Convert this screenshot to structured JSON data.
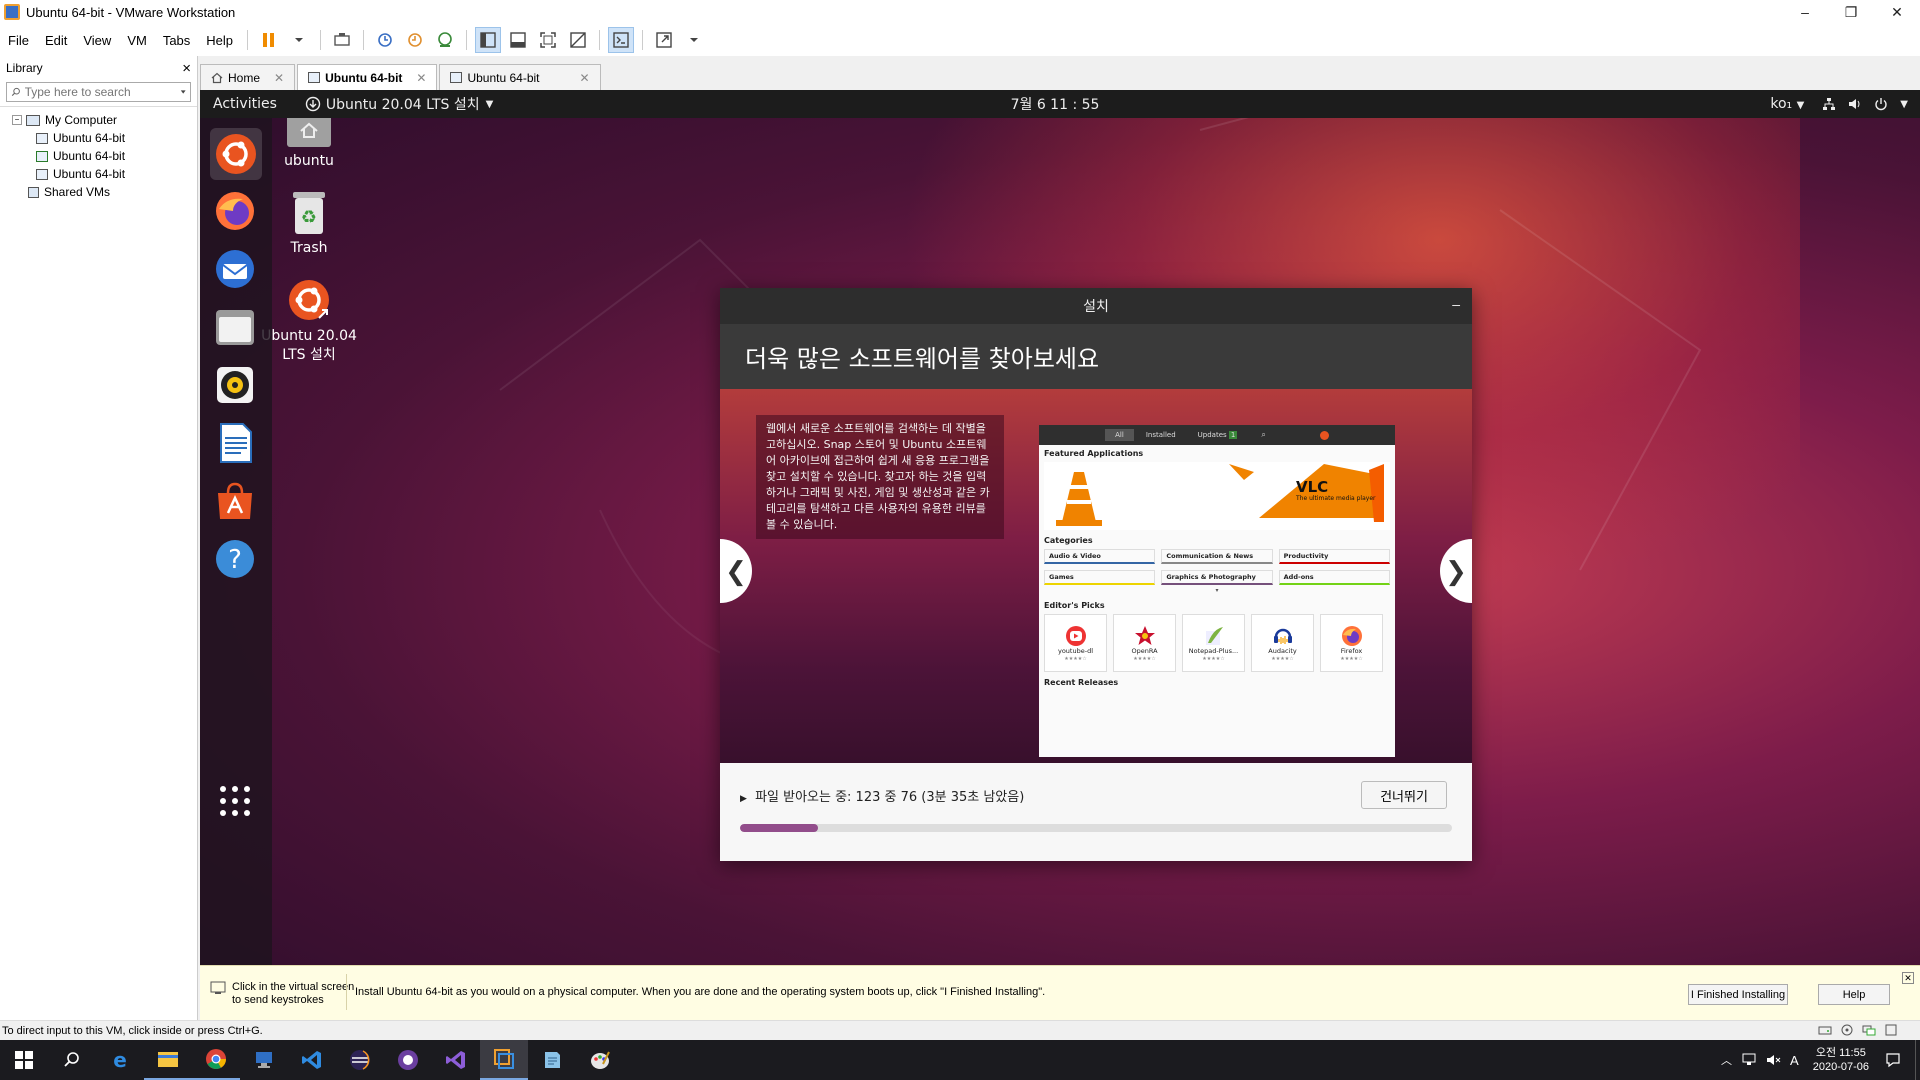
{
  "window": {
    "title": "Ubuntu 64-bit - VMware Workstation",
    "controls": [
      "–",
      "❐",
      "✕"
    ]
  },
  "menu": [
    "File",
    "Edit",
    "View",
    "VM",
    "Tabs",
    "Help"
  ],
  "library": {
    "title": "Library",
    "close": "×",
    "search_placeholder": "Type here to search",
    "tree": {
      "root": "My Computer",
      "vms": [
        "Ubuntu 64-bit",
        "Ubuntu 64-bit",
        "Ubuntu 64-bit"
      ],
      "shared": "Shared VMs"
    }
  },
  "tabs": [
    {
      "label": "Home",
      "active": false
    },
    {
      "label": "Ubuntu 64-bit",
      "active": true
    },
    {
      "label": "Ubuntu 64-bit",
      "active": false
    }
  ],
  "gnome": {
    "activities": "Activities",
    "app_menu": "Ubuntu 20.04 LTS 설치",
    "clock": "7월 6 11 : 55",
    "input_method": "ko₁"
  },
  "desktop": {
    "icons": [
      {
        "label": "ubuntu",
        "icon": "home-folder-icon"
      },
      {
        "label": "Trash",
        "icon": "trash-icon"
      },
      {
        "label": "Ubuntu 20.04 LTS 설치",
        "icon": "ubuntu-installer-icon"
      }
    ]
  },
  "dock": [
    "ubuntu-installer-icon",
    "firefox-icon",
    "thunderbird-icon",
    "files-icon",
    "rhythmbox-icon",
    "libreoffice-writer-icon",
    "software-center-icon",
    "help-icon",
    "show-applications-icon"
  ],
  "installer": {
    "window_title": "설치",
    "minimize": "–",
    "heading": "더욱 많은 소프트웨어를 찾아보세요",
    "slide_text": "웹에서 새로운 소프트웨어를 검색하는 데 작별을 고하십시오. Snap 스토어 및 Ubuntu 소프트웨어 아카이브에 접근하여 쉽게 새 응용 프로그램을 찾고 설치할 수 있습니다. 찾고자 하는 것을 입력하거나 그래픽 및 사진, 게임 및 생산성과 같은 카테고리를 탐색하고 다른 사용자의 유용한 리뷰를 볼 수 있습니다.",
    "prev": "❮",
    "next": "❯",
    "software_center": {
      "tabs": [
        "All",
        "Installed",
        "Updates"
      ],
      "updates_badge": "1",
      "featured_label": "Featured Applications",
      "banner_title": "VLC",
      "banner_subtitle": "The ultimate media player",
      "categories_label": "Categories",
      "categories": [
        "Audio & Video",
        "Communication & News",
        "Productivity",
        "Games",
        "Graphics & Photography",
        "Add-ons"
      ],
      "category_colors": [
        "#3465a4",
        "#888888",
        "#cc0000",
        "#edd400",
        "#75507b",
        "#73d216"
      ],
      "editors_picks_label": "Editor's Picks",
      "picks": [
        "youtube-dl",
        "OpenRA",
        "Notepad-Plus...",
        "Audacity",
        "Firefox"
      ],
      "stars": "★★★★☆",
      "recent_label": "Recent Releases"
    },
    "status": "파일 받아오는 중: 123 중 76 (3분 35초 남았음)",
    "skip_button": "건너뛰기",
    "progress": 0.11,
    "progress_color": "#924d8b"
  },
  "hint": {
    "click_hint_1": "Click in the virtual screen",
    "click_hint_2": "to send keystrokes",
    "message": "Install Ubuntu 64-bit as you would on a physical computer. When you are done and the operating system boots up, click \"I Finished Installing\".",
    "finished_button": "I Finished Installing",
    "help_button": "Help",
    "close": "✕"
  },
  "statusbar": {
    "text": "To direct input to this VM, click inside or press Ctrl+G."
  },
  "taskbar": {
    "ime": "A",
    "time_line1": "오전 11:55",
    "time_line2": "2020-07-06"
  }
}
